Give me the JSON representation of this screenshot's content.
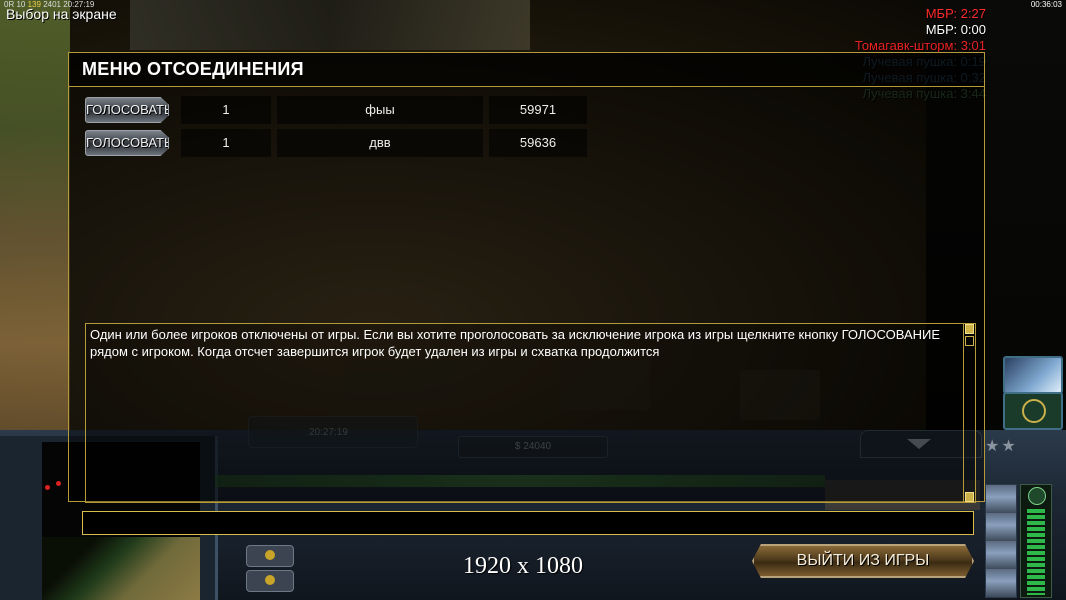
{
  "hud": {
    "top_left_small": "0R 10",
    "top_left_small_2": "139",
    "top_left_small_3": "2401",
    "top_left_time": "20:27:19",
    "title": "Выбор на экране",
    "clock": "00:36:03"
  },
  "timers": [
    {
      "text": "МБР: 2:27",
      "color": "#ff2a2a"
    },
    {
      "text": "МБР: 0:00",
      "color": "#ffffff"
    },
    {
      "text": "Томагавк-шторм: 3:01",
      "color": "#e82222"
    },
    {
      "text": "Лучевая пушка: 0:19",
      "color": "#3a6a8a"
    },
    {
      "text": "Лучевая пушка: 0:32",
      "color": "#3a6a8a"
    },
    {
      "text": "Лучевая пушка: 3:44",
      "color": "#2f4a2f"
    }
  ],
  "dialog": {
    "title": "МЕНЮ ОТСОЕДИНЕНИЯ",
    "vote_label": "ГОЛОСОВАТЬ",
    "players": [
      {
        "slot": "1",
        "name": "фыы",
        "ping": "59971"
      },
      {
        "slot": "1",
        "name": "двв",
        "ping": "59636"
      }
    ],
    "message": "Один или более игроков отключены от игры. Если вы хотите проголосовать за исключение игрока из игры щелкните кнопку  ГОЛОСОВАНИЕ рядом с игроком. Когда отсчет завершится игрок будет удален из игры и схватка продолжится",
    "chat_value": "",
    "exit_label": "ВЫЙТИ ИЗ ИГРЫ"
  },
  "control_bar": {
    "game_time": "20:27:19",
    "money": "$ 24040",
    "resolution_label": "1920 x 1080"
  },
  "colors": {
    "dialog_border": "#b59a3a",
    "exit_button": "#5a4422"
  }
}
